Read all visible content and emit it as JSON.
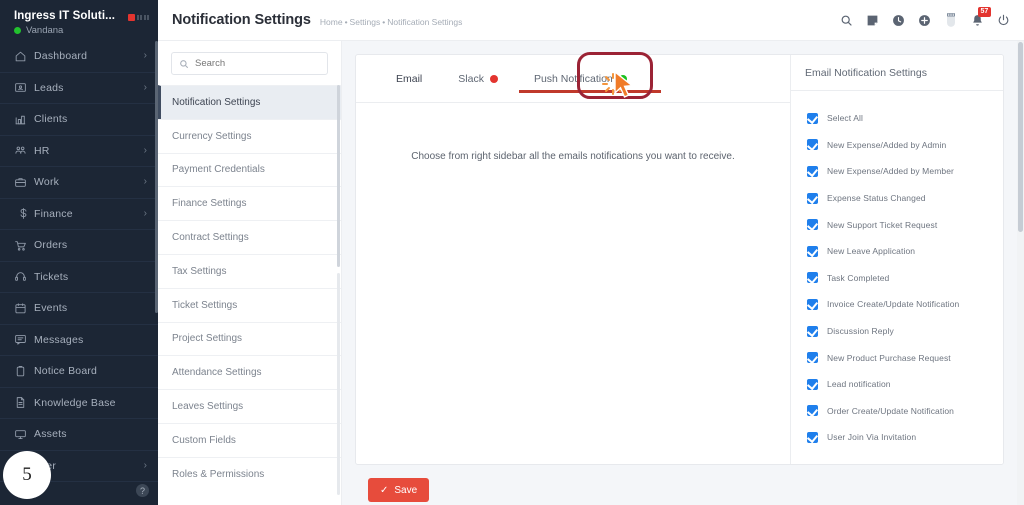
{
  "sidebar": {
    "brand": {
      "company": "Ingress IT Soluti...",
      "user": "Vandana",
      "status_color": "#22c12e",
      "logo_icon": "red-square-logo-icon"
    },
    "items": [
      {
        "label": "Dashboard",
        "icon": "home-icon",
        "chevron": "›"
      },
      {
        "label": "Leads",
        "icon": "id-card-icon",
        "chevron": "›"
      },
      {
        "label": "Clients",
        "icon": "bar-chart-icon",
        "chevron": ""
      },
      {
        "label": "HR",
        "icon": "users-icon",
        "chevron": "›"
      },
      {
        "label": "Work",
        "icon": "briefcase-icon",
        "chevron": "›"
      },
      {
        "label": "Finance",
        "icon": "dollar-icon",
        "chevron": "›"
      },
      {
        "label": "Orders",
        "icon": "shopping-cart-icon",
        "chevron": ""
      },
      {
        "label": "Tickets",
        "icon": "headset-icon",
        "chevron": ""
      },
      {
        "label": "Events",
        "icon": "calendar-icon",
        "chevron": ""
      },
      {
        "label": "Messages",
        "icon": "chat-icon",
        "chevron": ""
      },
      {
        "label": "Notice Board",
        "icon": "clipboard-icon",
        "chevron": ""
      },
      {
        "label": "Knowledge Base",
        "icon": "file-text-icon",
        "chevron": ""
      },
      {
        "label": "Assets",
        "icon": "monitor-icon",
        "chevron": ""
      },
      {
        "label": "etter",
        "icon": "newsletter-icon",
        "chevron": "›"
      }
    ],
    "help_label": "?",
    "step_number": "5"
  },
  "header": {
    "title": "Notification Settings",
    "breadcrumb": [
      "Home",
      "Settings",
      "Notification Settings"
    ],
    "breadcrumb_separator": "•",
    "icons": [
      {
        "name": "search-icon"
      },
      {
        "name": "note-icon"
      },
      {
        "name": "clock-icon"
      },
      {
        "name": "plus-circle-icon"
      },
      {
        "name": "gift-icon"
      },
      {
        "name": "bell-icon",
        "badge": "57",
        "badge_color": "#e3342f"
      },
      {
        "name": "power-icon"
      }
    ]
  },
  "settings_menu": {
    "search": {
      "placeholder": "Search",
      "value": "",
      "icon": "search-icon"
    },
    "items": [
      {
        "label": "Notification Settings",
        "active": true
      },
      {
        "label": "Currency Settings",
        "active": false
      },
      {
        "label": "Payment Credentials",
        "active": false
      },
      {
        "label": "Finance Settings",
        "active": false
      },
      {
        "label": "Contract Settings",
        "active": false
      },
      {
        "label": "Tax Settings",
        "active": false
      },
      {
        "label": "Ticket Settings",
        "active": false
      },
      {
        "label": "Project Settings",
        "active": false
      },
      {
        "label": "Attendance Settings",
        "active": false
      },
      {
        "label": "Leaves Settings",
        "active": false
      },
      {
        "label": "Custom Fields",
        "active": false
      },
      {
        "label": "Roles & Permissions",
        "active": false
      }
    ]
  },
  "content": {
    "tabs": [
      {
        "label": "Email",
        "active": true,
        "dot_color": ""
      },
      {
        "label": "Slack",
        "active": false,
        "dot_color": "#e3342f"
      },
      {
        "label": "Push Notification",
        "active": false,
        "dot_color": "#19c11f"
      }
    ],
    "hint": "Choose from right sidebar all the emails notifications you want to receive.",
    "save_button": {
      "label": "Save",
      "icon": "check-icon",
      "color": "#e74c3c"
    }
  },
  "notification_panel": {
    "title": "Email Notification Settings",
    "checkbox_color": "#1f7fec",
    "options": [
      {
        "label": "Select All",
        "checked": true
      },
      {
        "label": "New Expense/Added by Admin",
        "checked": true
      },
      {
        "label": "New Expense/Added by Member",
        "checked": true
      },
      {
        "label": "Expense Status Changed",
        "checked": true
      },
      {
        "label": "New Support Ticket Request",
        "checked": true
      },
      {
        "label": "New Leave Application",
        "checked": true
      },
      {
        "label": "Task Completed",
        "checked": true
      },
      {
        "label": "Invoice Create/Update Notification",
        "checked": true
      },
      {
        "label": "Discussion Reply",
        "checked": true
      },
      {
        "label": "New Product Purchase Request",
        "checked": true
      },
      {
        "label": "Lead notification",
        "checked": true
      },
      {
        "label": "Order Create/Update Notification",
        "checked": true
      },
      {
        "label": "User Join Via Invitation",
        "checked": true
      }
    ]
  },
  "annotation": {
    "highlight_target": "Slack",
    "box_color": "#9b2335",
    "underline_color": "#c0392b",
    "cursor_color": "#f07b28"
  }
}
